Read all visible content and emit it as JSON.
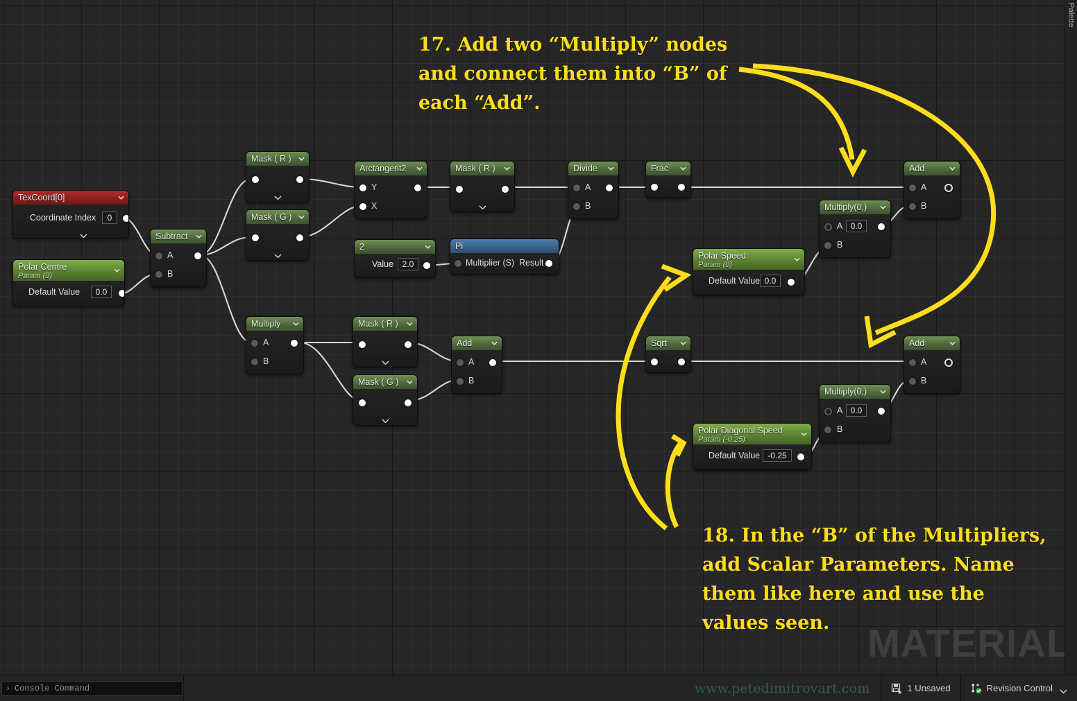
{
  "app": {
    "palette_label": "Palette",
    "watermark": "MATERIAL"
  },
  "annotations": [
    {
      "id": "step-17",
      "text": "17. Add two “Multiply” nodes\nand connect them into “B” of\neach “Add”.",
      "color": "#ffdd1c"
    },
    {
      "id": "step-18",
      "text": "18. In the “B” of the Multipliers,\nadd Scalar Parameters. Name\nthem like here and use the\nvalues seen.",
      "color": "#ffdd1c"
    }
  ],
  "nodes": {
    "texcoord": {
      "title": "TexCoord[0]",
      "field_label": "Coordinate Index",
      "field_value": "0",
      "accent": "#b22b2b"
    },
    "polar_centre": {
      "title": "Polar Centre",
      "subtitle": "Param (0)",
      "field_label": "Default Value",
      "field_value": "0.0",
      "accent": "#7faf4a"
    },
    "subtract": {
      "title": "Subtract",
      "in_a": "A",
      "in_b": "B"
    },
    "mask_r_top": {
      "title": "Mask ( R )"
    },
    "mask_g_top": {
      "title": "Mask ( G )"
    },
    "arctangent2": {
      "title": "Arctangent2",
      "in_y": "Y",
      "in_x": "X"
    },
    "const_two": {
      "title": "2",
      "field_label": "Value",
      "field_value": "2.0"
    },
    "mask_r_2": {
      "title": "Mask ( R )"
    },
    "pi": {
      "title": "Pi",
      "in_label": "Multiplier (S)",
      "out_label": "Result",
      "accent": "#4d7ea8"
    },
    "divide": {
      "title": "Divide",
      "in_a": "A",
      "in_b": "B"
    },
    "frac": {
      "title": "Frac"
    },
    "add_top": {
      "title": "Add",
      "in_a": "A",
      "in_b": "B"
    },
    "multiply_top": {
      "title": "Multiply(0,)",
      "in_a": "A",
      "in_a_value": "0.0",
      "in_b": "B"
    },
    "polar_speed": {
      "title": "Polar Speed",
      "subtitle": "Param (0)",
      "field_label": "Default Value",
      "field_value": "0.0",
      "accent": "#7faf4a"
    },
    "multiply_left": {
      "title": "Multiply",
      "in_a": "A",
      "in_b": "B"
    },
    "mask_r_bot": {
      "title": "Mask ( R )"
    },
    "mask_g_bot": {
      "title": "Mask ( G )"
    },
    "add_bot_left": {
      "title": "Add",
      "in_a": "A",
      "in_b": "B"
    },
    "sqrt": {
      "title": "Sqrt"
    },
    "add_bot": {
      "title": "Add",
      "in_a": "A",
      "in_b": "B"
    },
    "multiply_bot": {
      "title": "Multiply(0,)",
      "in_a": "A",
      "in_a_value": "0.0",
      "in_b": "B"
    },
    "polar_diagonal_speed": {
      "title": "Polar Diagonal Speed",
      "subtitle": "Param (-0.25)",
      "field_label": "Default Value",
      "field_value": "-0.25",
      "accent": "#7faf4a"
    }
  },
  "statusbar": {
    "console_placeholder": "Console Command",
    "console_value": "",
    "console_prompt": "⌘",
    "site_url": "www.petedimitrovart.com",
    "unsaved_label": "1 Unsaved",
    "revision_label": "Revision Control"
  }
}
